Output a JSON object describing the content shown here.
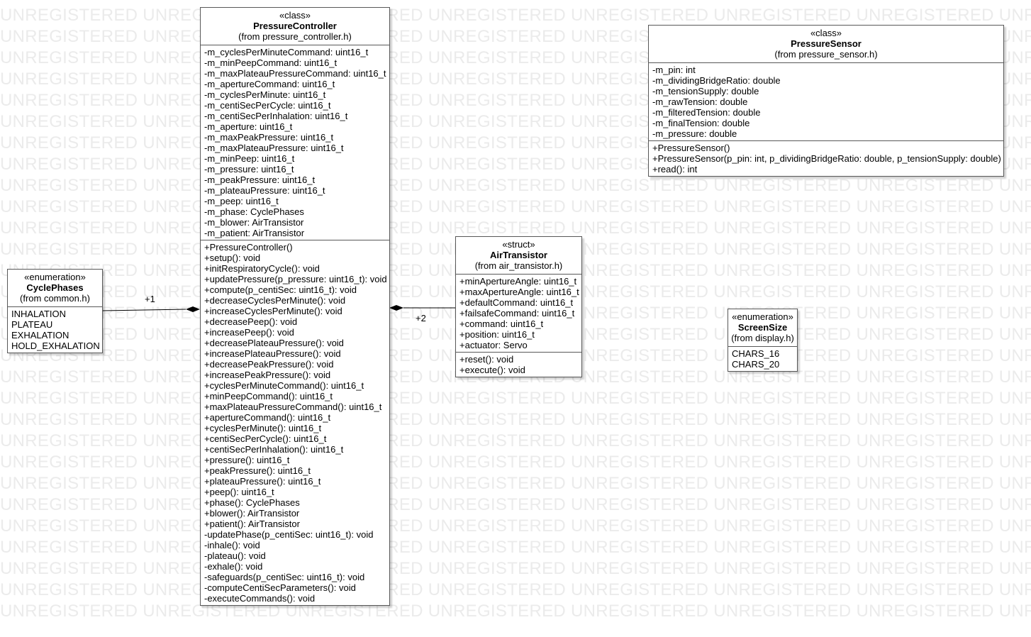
{
  "watermark": "UNREGISTERED",
  "classes": {
    "pressure_controller": {
      "stereotype": "«class»",
      "name": "PressureController",
      "source": "(from pressure_controller.h)",
      "attributes": [
        "-m_cyclesPerMinuteCommand: uint16_t",
        "-m_minPeepCommand: uint16_t",
        "-m_maxPlateauPressureCommand: uint16_t",
        "-m_apertureCommand: uint16_t",
        "-m_cyclesPerMinute: uint16_t",
        "-m_centiSecPerCycle: uint16_t",
        "-m_centiSecPerInhalation: uint16_t",
        "-m_aperture: uint16_t",
        "-m_maxPeakPressure: uint16_t",
        "-m_maxPlateauPressure: uint16_t",
        "-m_minPeep: uint16_t",
        "-m_pressure: uint16_t",
        "-m_peakPressure: uint16_t",
        "-m_plateauPressure: uint16_t",
        "-m_peep: uint16_t",
        "-m_phase: CyclePhases",
        "-m_blower: AirTransistor",
        "-m_patient: AirTransistor"
      ],
      "operations": [
        "+PressureController()",
        "+setup(): void",
        "+initRespiratoryCycle(): void",
        "+updatePressure(p_pressure: uint16_t): void",
        "+compute(p_centiSec: uint16_t): void",
        "+decreaseCyclesPerMinute(): void",
        "+increaseCyclesPerMinute(): void",
        "+decreasePeep(): void",
        "+increasePeep(): void",
        "+decreasePlateauPressure(): void",
        "+increasePlateauPressure(): void",
        "+decreasePeakPressure(): void",
        "+increasePeakPressure(): void",
        "+cyclesPerMinuteCommand(): uint16_t",
        "+minPeepCommand(): uint16_t",
        "+maxPlateauPressureCommand(): uint16_t",
        "+apertureCommand(): uint16_t",
        "+cyclesPerMinute(): uint16_t",
        "+centiSecPerCycle(): uint16_t",
        "+centiSecPerInhalation(): uint16_t",
        "+pressure(): uint16_t",
        "+peakPressure(): uint16_t",
        "+plateauPressure(): uint16_t",
        "+peep(): uint16_t",
        "+phase(): CyclePhases",
        "+blower(): AirTransistor",
        "+patient(): AirTransistor",
        "-updatePhase(p_centiSec: uint16_t): void",
        "-inhale(): void",
        "-plateau(): void",
        "-exhale(): void",
        "-safeguards(p_centiSec: uint16_t): void",
        "-computeCentiSecParameters(): void",
        "-executeCommands(): void"
      ]
    },
    "pressure_sensor": {
      "stereotype": "«class»",
      "name": "PressureSensor",
      "source": "(from pressure_sensor.h)",
      "attributes": [
        "-m_pin: int",
        "-m_dividingBridgeRatio: double",
        "-m_tensionSupply: double",
        "-m_rawTension: double",
        "-m_filteredTension: double",
        "-m_finalTension: double",
        "-m_pressure: double"
      ],
      "operations": [
        "+PressureSensor()",
        "+PressureSensor(p_pin: int, p_dividingBridgeRatio: double, p_tensionSupply: double)",
        "+read(): int"
      ]
    },
    "air_transistor": {
      "stereotype": "«struct»",
      "name": "AirTransistor",
      "source": "(from air_transistor.h)",
      "attributes": [
        "+minApertureAngle: uint16_t",
        "+maxApertureAngle: uint16_t",
        "+defaultCommand: uint16_t",
        "+failsafeCommand: uint16_t",
        "+command: uint16_t",
        "+position: uint16_t",
        "+actuator: Servo"
      ],
      "operations": [
        "+reset(): void",
        "+execute(): void"
      ]
    },
    "cycle_phases": {
      "stereotype": "«enumeration»",
      "name": "CyclePhases",
      "source": "(from common.h)",
      "literals": [
        "INHALATION",
        "PLATEAU",
        "EXHALATION",
        "HOLD_EXHALATION"
      ]
    },
    "screen_size": {
      "stereotype": "«enumeration»",
      "name": "ScreenSize",
      "source": "(from display.h)",
      "literals": [
        "CHARS_16",
        "CHARS_20"
      ]
    }
  },
  "associations": [
    {
      "from": "PressureController",
      "to": "CyclePhases",
      "multiplicity": "+1",
      "kind": "composition"
    },
    {
      "from": "PressureController",
      "to": "AirTransistor",
      "multiplicity": "+2",
      "kind": "composition"
    }
  ]
}
